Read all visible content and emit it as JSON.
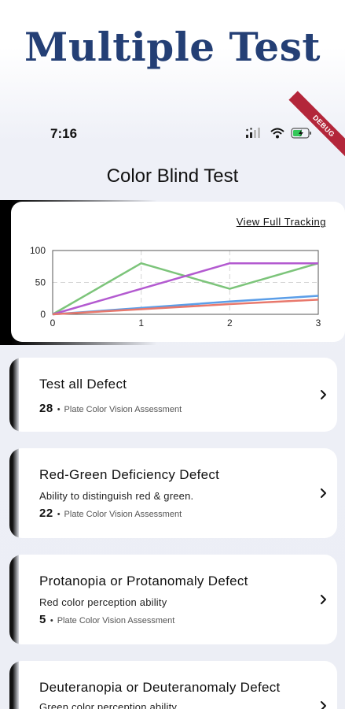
{
  "banner": {
    "title": "Multiple Test"
  },
  "status_bar": {
    "time": "7:16",
    "debug_label": "DEBUG"
  },
  "header": {
    "title": "Color Blind Test"
  },
  "chart_card": {
    "link_label": "View Full Tracking"
  },
  "chart_data": {
    "type": "line",
    "x": [
      0,
      1,
      2,
      3
    ],
    "xlim": [
      0,
      3
    ],
    "ylim": [
      0,
      100
    ],
    "x_ticks": [
      "0",
      "1",
      "2",
      "3"
    ],
    "y_ticks": [
      "0",
      "50",
      "100"
    ],
    "grid": true,
    "series": [
      {
        "color": "#7cc47a",
        "values": [
          0,
          80,
          40,
          80
        ]
      },
      {
        "color": "#b35ad0",
        "values": [
          0,
          40,
          80,
          80
        ]
      },
      {
        "color": "#5b9ee8",
        "values": [
          0,
          10,
          20,
          29
        ]
      },
      {
        "color": "#e8786c",
        "values": [
          0,
          8,
          16,
          23
        ]
      }
    ]
  },
  "tests": [
    {
      "title": "Test all Defect",
      "subtitle": "",
      "count": "28",
      "meta": "Plate Color Vision Assessment"
    },
    {
      "title": "Red-Green Deficiency Defect",
      "subtitle": "Ability to distinguish red & green.",
      "count": "22",
      "meta": "Plate Color Vision Assessment"
    },
    {
      "title": "Protanopia or Protanomaly Defect",
      "subtitle": "Red color perception ability",
      "count": "5",
      "meta": "Plate Color Vision Assessment"
    },
    {
      "title": "Deuteranopia or Deuteranomaly Defect",
      "subtitle": "Green color perception ability",
      "count": "",
      "meta": ""
    }
  ],
  "icons": {
    "chevron": "chevron-right-icon",
    "wifi": "wifi-icon",
    "signal": "signal-icon",
    "battery": "battery-charging-icon"
  }
}
